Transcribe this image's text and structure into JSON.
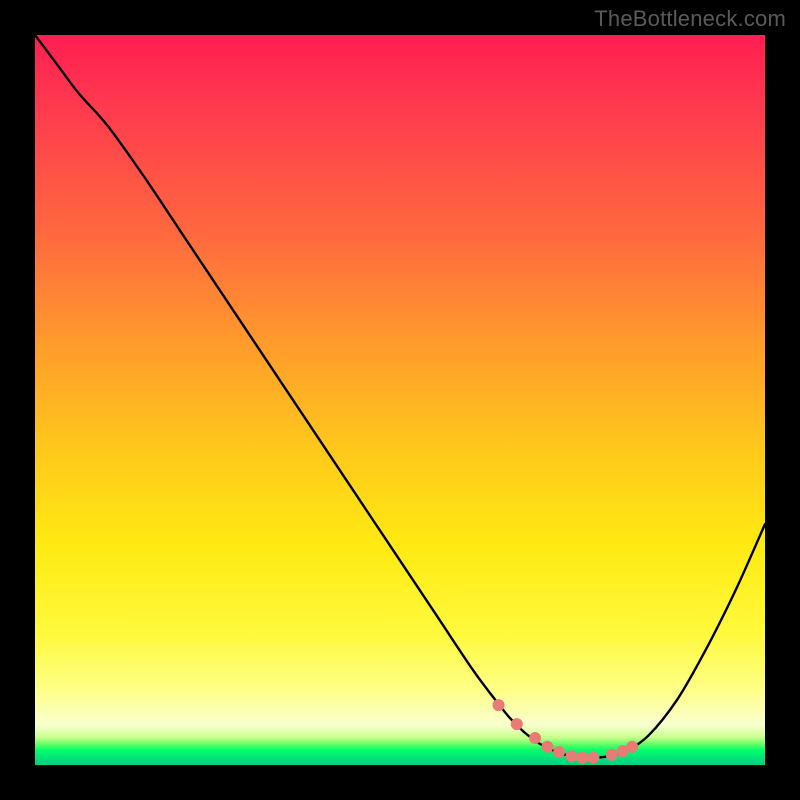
{
  "watermark": "TheBottleneck.com",
  "chart_data": {
    "type": "line",
    "title": "",
    "xlabel": "",
    "ylabel": "",
    "xlim": [
      0,
      100
    ],
    "ylim": [
      0,
      100
    ],
    "grid": false,
    "legend": false,
    "background": "rainbow-vertical-gradient",
    "frame_color": "#000000",
    "series": [
      {
        "name": "bottleneck-curve",
        "color": "#000000",
        "stroke_width": 2,
        "x": [
          0,
          3,
          6,
          10,
          15,
          20,
          25,
          30,
          35,
          40,
          45,
          50,
          55,
          60,
          63,
          65,
          67,
          69,
          71,
          73,
          75,
          77,
          79,
          81,
          84,
          88,
          92,
          96,
          100
        ],
        "y": [
          100,
          96,
          92,
          87.5,
          80.5,
          73,
          65.5,
          58,
          50.5,
          43,
          35.5,
          28,
          20.5,
          13,
          9,
          6.5,
          4.5,
          3,
          2,
          1.3,
          1,
          1,
          1.3,
          2,
          4,
          9,
          16,
          24,
          33
        ]
      }
    ],
    "markers": {
      "name": "highlight-dots",
      "color": "#e87b75",
      "radius": 6,
      "x": [
        63.5,
        66,
        68.5,
        70.2,
        71.8,
        73.5,
        75,
        76.5,
        79,
        80.5,
        81.8
      ],
      "y": [
        8.2,
        5.6,
        3.7,
        2.5,
        1.8,
        1.2,
        1.0,
        1.0,
        1.4,
        1.9,
        2.5
      ]
    }
  }
}
